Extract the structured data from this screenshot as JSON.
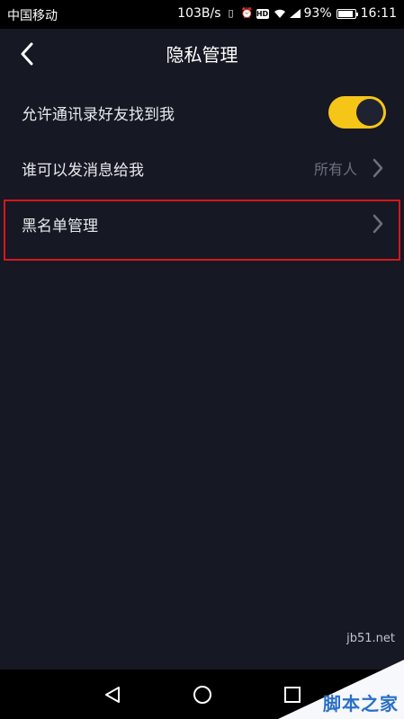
{
  "status_bar": {
    "carrier": "中国移动",
    "speed": "103B/s",
    "battery_percent": "93%",
    "battery_level": 0.93,
    "time": "16:11"
  },
  "header": {
    "title": "隐私管理"
  },
  "settings": {
    "allow_contacts": {
      "label": "允许通讯录好友找到我",
      "enabled": true
    },
    "who_can_message": {
      "label": "谁可以发消息给我",
      "value": "所有人"
    },
    "blacklist": {
      "label": "黑名单管理"
    }
  },
  "watermark": {
    "site": "jb51.net",
    "brand": "脚本之家"
  },
  "colors": {
    "background": "#161823",
    "toggle_on": "#f5c518",
    "highlight": "#d8161e",
    "muted_text": "#6e7080"
  },
  "icons": [
    "back-icon",
    "chevron-right-icon",
    "back-triangle-icon",
    "home-circle-icon",
    "recents-square-icon"
  ]
}
